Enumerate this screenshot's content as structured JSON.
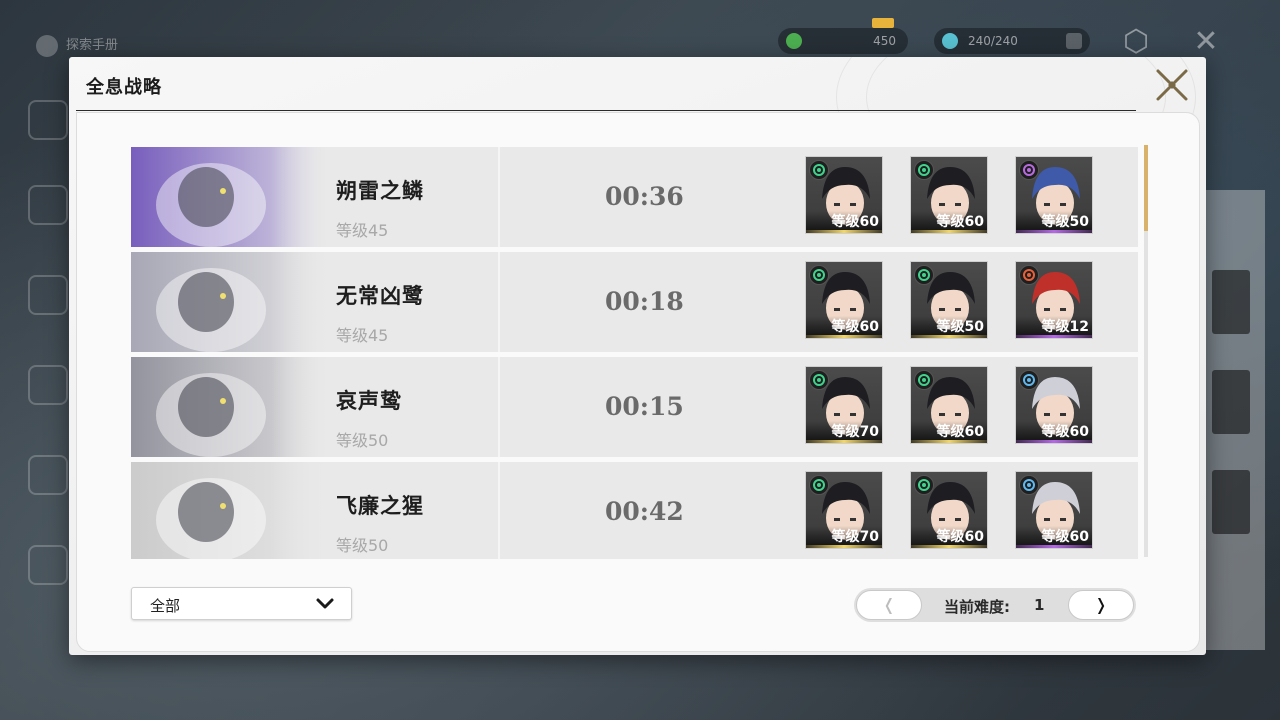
{
  "background": {
    "title": "探索手册",
    "currency1": "450",
    "currency2": "240/240"
  },
  "dialog": {
    "title": "全息战略"
  },
  "bosses": [
    {
      "name": "朔雷之鳞",
      "level": "等级45",
      "time": "00:36",
      "portrait_tint": "#6b4fb8",
      "team": [
        {
          "element": "aero-icon",
          "element_color": "#3fd38c",
          "level": "等级60",
          "rarity": "gold"
        },
        {
          "element": "aero-icon",
          "element_color": "#3fd38c",
          "level": "等级60",
          "rarity": "gold"
        },
        {
          "element": "havoc-icon",
          "element_color": "#b86be0",
          "level": "等级50",
          "rarity": "purple"
        }
      ]
    },
    {
      "name": "无常凶鹭",
      "level": "等级45",
      "time": "00:18",
      "portrait_tint": "#a0a0b0",
      "team": [
        {
          "element": "aero-icon",
          "element_color": "#3fd38c",
          "level": "等级60",
          "rarity": "gold"
        },
        {
          "element": "aero-icon",
          "element_color": "#3fd38c",
          "level": "等级50",
          "rarity": "gold"
        },
        {
          "element": "fusion-icon",
          "element_color": "#e8603a",
          "level": "等级12",
          "rarity": "purple"
        }
      ]
    },
    {
      "name": "哀声鸷",
      "level": "等级50",
      "time": "00:15",
      "portrait_tint": "#8a8a96",
      "team": [
        {
          "element": "aero-icon",
          "element_color": "#3fd38c",
          "level": "等级70",
          "rarity": "gold"
        },
        {
          "element": "aero-icon",
          "element_color": "#3fd38c",
          "level": "等级60",
          "rarity": "gold"
        },
        {
          "element": "glacio-icon",
          "element_color": "#5fb8ef",
          "level": "等级60",
          "rarity": "purple"
        }
      ]
    },
    {
      "name": "飞廉之猩",
      "level": "等级50",
      "time": "00:42",
      "portrait_tint": "#c8c8c8",
      "team": [
        {
          "element": "aero-icon",
          "element_color": "#3fd38c",
          "level": "等级70",
          "rarity": "gold"
        },
        {
          "element": "aero-icon",
          "element_color": "#3fd38c",
          "level": "等级60",
          "rarity": "gold"
        },
        {
          "element": "glacio-icon",
          "element_color": "#5fb8ef",
          "level": "等级60",
          "rarity": "purple"
        }
      ]
    }
  ],
  "filter": {
    "selected": "全部"
  },
  "pager": {
    "prev": "❬",
    "next": "❭",
    "label": "当前难度:",
    "value": "1"
  }
}
